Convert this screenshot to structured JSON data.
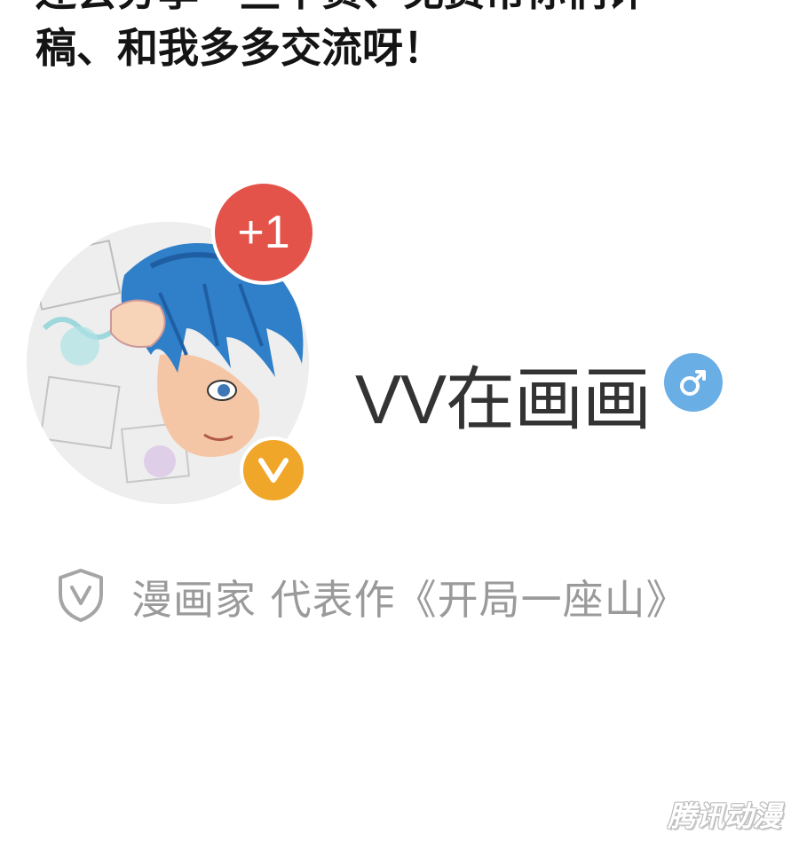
{
  "caption": {
    "line1": "还会分享一些干货、免费帮你们评",
    "line2": "稿、和我多多交流呀！"
  },
  "profile": {
    "avatar_icon": "anime-character-avatar",
    "notification_count": "+1",
    "verified_mark": "V",
    "username": "VV在画画",
    "gender_icon": "male-icon",
    "certification_icon": "shield-v-icon",
    "certification": "漫画家 代表作《开局一座山》"
  },
  "watermark": "腾讯动漫",
  "colors": {
    "badge_red": "#e4534a",
    "verified_orange": "#f0a629",
    "gender_blue": "#6aaee6",
    "text_dark": "#333333",
    "text_gray": "#9a9a9a"
  }
}
